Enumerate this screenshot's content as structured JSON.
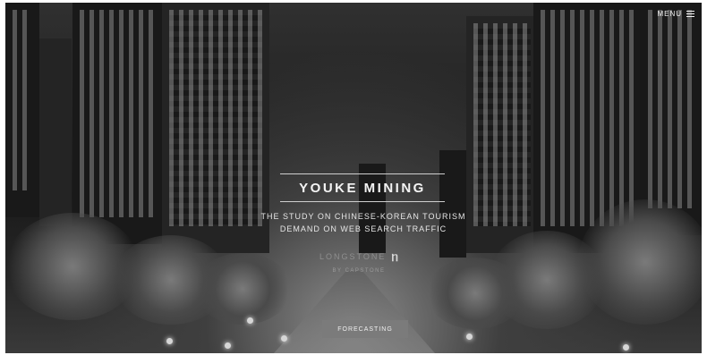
{
  "nav": {
    "menu_label": "MENU"
  },
  "hero": {
    "title": "YOUKE MINING",
    "subtitle_line1": "THE STUDY ON CHINESE-KOREAN TOURISM",
    "subtitle_line2": "DEMAND ON WEB SEARCH TRAFFIC",
    "logo_text": "LONGSTONE",
    "logo_sub": "BY CAPSTONE",
    "cta_label": "FORECASTING"
  },
  "colors": {
    "overlay": "#1b1b1b",
    "button": "#7b7b7b",
    "text": "#f4f4f4"
  }
}
